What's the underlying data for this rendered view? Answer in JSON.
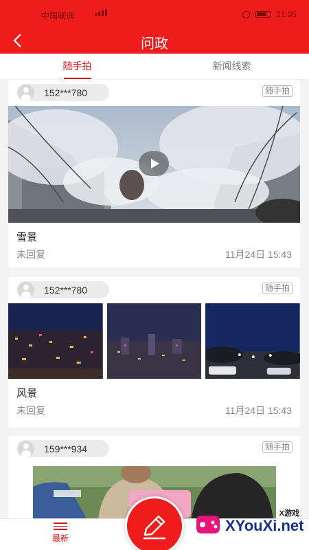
{
  "status_bar": {
    "carrier": "中国联通",
    "network": "HD",
    "time": "21:05"
  },
  "nav": {
    "title": "问政"
  },
  "tabs": [
    {
      "label": "随手拍",
      "active": true
    },
    {
      "label": "新闻线索",
      "active": false
    }
  ],
  "posts": [
    {
      "user": "152***780",
      "badge": "随手拍",
      "media": "video",
      "title": "雪景",
      "status": "未回复",
      "time": "11月24日 15:43"
    },
    {
      "user": "152***780",
      "badge": "随手拍",
      "media": "images",
      "title": "风景",
      "status": "未回复",
      "time": "11月24日 15:43"
    },
    {
      "user": "159***934",
      "badge": "随手拍",
      "media": "image"
    }
  ],
  "bottom_bar": {
    "latest_label": "最新"
  },
  "watermark": {
    "brand": "XYouXi.net",
    "small": "X游戏"
  },
  "colors": {
    "primary_red": "#ee1c1c",
    "active_text": "#d9161c"
  },
  "icons": [
    "back-icon",
    "avatar-icon",
    "play-icon",
    "menu-icon",
    "pencil-icon"
  ]
}
